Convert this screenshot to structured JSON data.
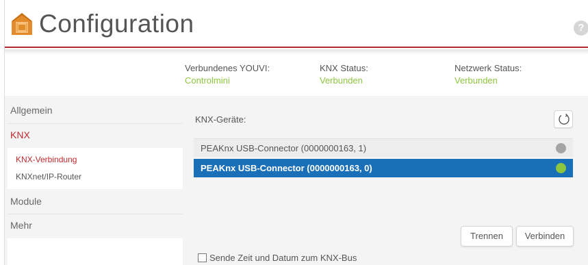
{
  "header": {
    "title": "Configuration",
    "help_label": "?",
    "accent_color": "#b3282d"
  },
  "status": {
    "youvi_label": "Verbundenes YOUVI:",
    "youvi_value": "Controlmini",
    "knx_label": "KNX Status:",
    "knx_value": "Verbunden",
    "network_label": "Netzwerk Status:",
    "network_value": "Verbunden",
    "ok_color": "#8cc63e"
  },
  "sidebar": {
    "items": [
      {
        "label": "Allgemein"
      },
      {
        "label": "KNX"
      },
      {
        "label": "Module"
      },
      {
        "label": "Mehr"
      }
    ],
    "sub_items": [
      {
        "label": "KNX-Verbindung"
      },
      {
        "label": "KNXnet/IP-Router"
      }
    ]
  },
  "main": {
    "devices_label": "KNX-Geräte:",
    "devices": [
      {
        "name": "PEAKnx USB-Connector (0000000163, 1)",
        "status": "disconnected",
        "dot_color": "#a5a5a5"
      },
      {
        "name": "PEAKnx USB-Connector (0000000163, 0)",
        "status": "connected",
        "dot_color": "#8cc63e"
      }
    ],
    "disconnect_label": "Trennen",
    "connect_label": "Verbinden",
    "send_time_label": "Sende Zeit und Datum zum KNX-Bus",
    "selected_color": "#1a70b8"
  }
}
